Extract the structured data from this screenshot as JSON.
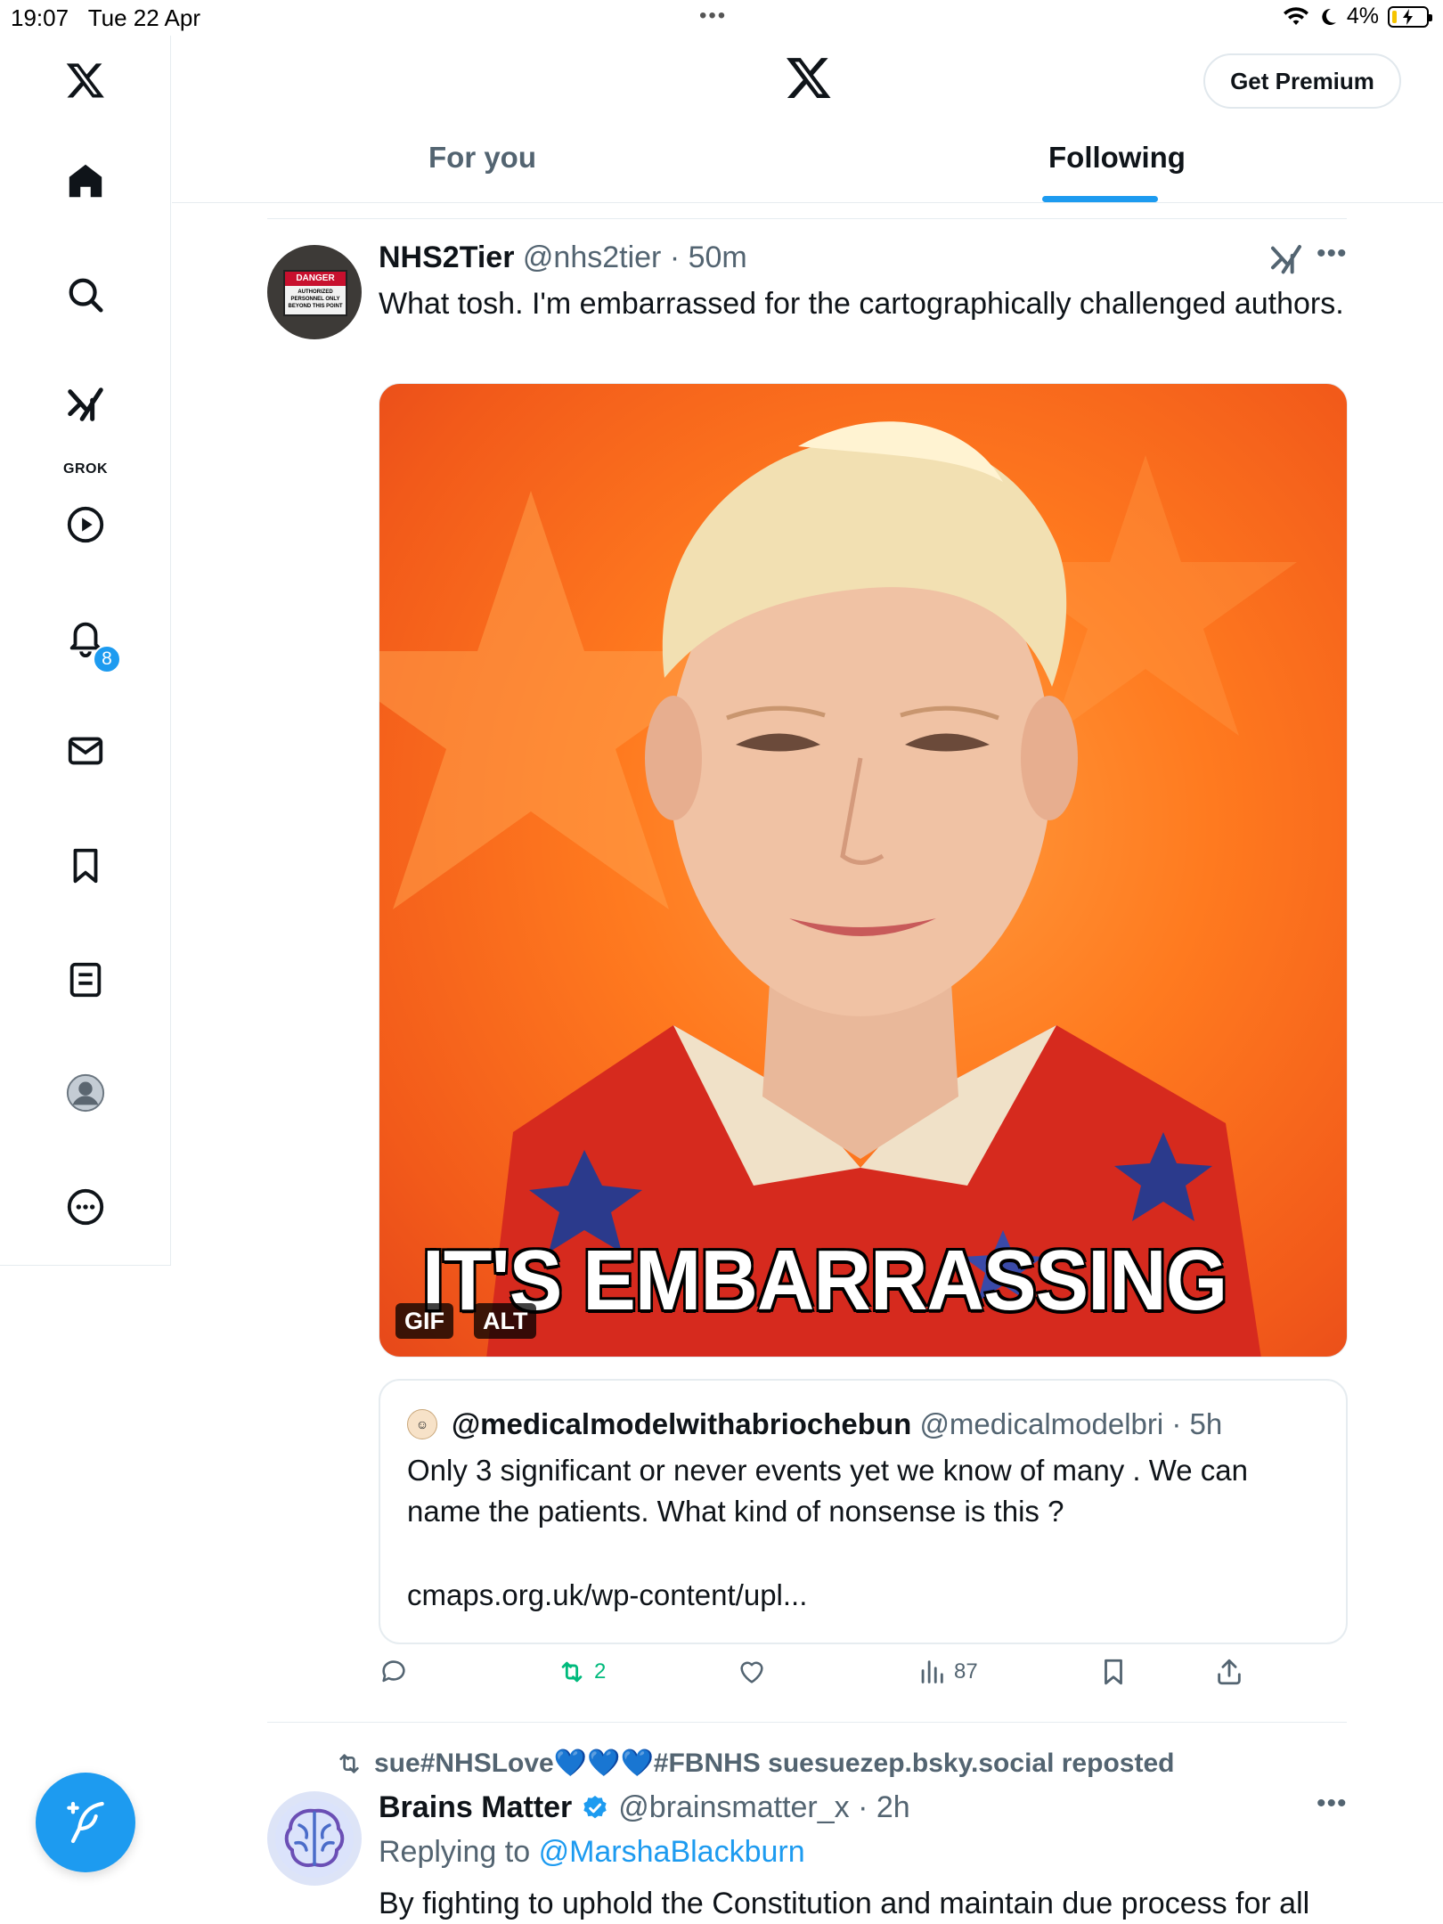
{
  "status_bar": {
    "time": "19:07",
    "date": "Tue 22 Apr",
    "battery": "4%"
  },
  "sidebar": {
    "items": [
      {
        "icon": "x-logo-icon"
      },
      {
        "icon": "home-icon"
      },
      {
        "icon": "search-icon"
      },
      {
        "icon": "grok-icon",
        "label": "GROK"
      },
      {
        "icon": "video-play-icon"
      },
      {
        "icon": "notifications-bell-icon",
        "badge": "8"
      },
      {
        "icon": "messages-envelope-icon"
      },
      {
        "icon": "bookmark-icon"
      },
      {
        "icon": "lists-icon"
      },
      {
        "icon": "profile-avatar-icon"
      },
      {
        "icon": "more-circle-icon"
      }
    ],
    "compose_icon": "compose-feather-icon"
  },
  "header": {
    "premium_label": "Get Premium",
    "tabs": [
      {
        "label": "For you",
        "active": false
      },
      {
        "label": "Following",
        "active": true
      }
    ]
  },
  "tweets": [
    {
      "name": "NHS2Tier",
      "handle": "@nhs2tier",
      "time": "50m",
      "text": "What tosh. I'm embarrassed for the cartographically challenged authors.",
      "media": {
        "caption": "IT'S EMBARRASSING",
        "badges": [
          "GIF",
          "ALT"
        ]
      },
      "quote": {
        "name": "@medicalmodelwithabriochebun",
        "handle": "@medicalmodelbri",
        "time": "5h",
        "text": "Only 3 significant or never events yet we know of many . We can name the patients. What kind of nonsense is this ?",
        "link": "cmaps.org.uk/wp-content/upl..."
      },
      "actions": {
        "replies": "",
        "retweets": "2",
        "likes": "",
        "views": "87"
      }
    },
    {
      "repost_by": "sue#NHSLove💙💙💙#FBNHS suesuezep.bsky.social reposted",
      "name": "Brains Matter",
      "handle": "@brainsmatter_x",
      "time": "2h",
      "reply_prefix": "Replying to",
      "reply_to": "@MarshaBlackburn",
      "text": "By fighting to uphold the Constitution and maintain due process for all"
    }
  ],
  "colors": {
    "accent": "#1d9bf0",
    "retweet_green": "#00ba7c",
    "secondary_text": "#536471"
  }
}
